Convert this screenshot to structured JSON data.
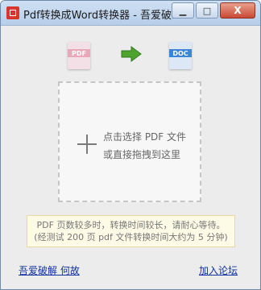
{
  "window": {
    "title": "Pdf转换成Word转换器 - 吾爱破...",
    "buttons": {
      "minimize": "▁",
      "maximize": "□",
      "close": "X"
    }
  },
  "icons": {
    "pdf_label": "PDF",
    "doc_label": "DOC"
  },
  "dropzone": {
    "line1": "点击选择 PDF 文件",
    "line2": "或直接拖拽到这里"
  },
  "notice": {
    "line1": "PDF 页数较多时，转换时间较长，请耐心等待。",
    "line2": "(经测试 200 页 pdf 文件转换时间大约为 5 分钟)"
  },
  "footer": {
    "left_link": "吾爱破解 何故",
    "right_link": "加入论坛"
  },
  "colors": {
    "accent_link": "#1030a0",
    "arrow_green": "#4fa32f",
    "pdf_pink": "#e9a7ba",
    "doc_blue": "#3d84d6"
  }
}
